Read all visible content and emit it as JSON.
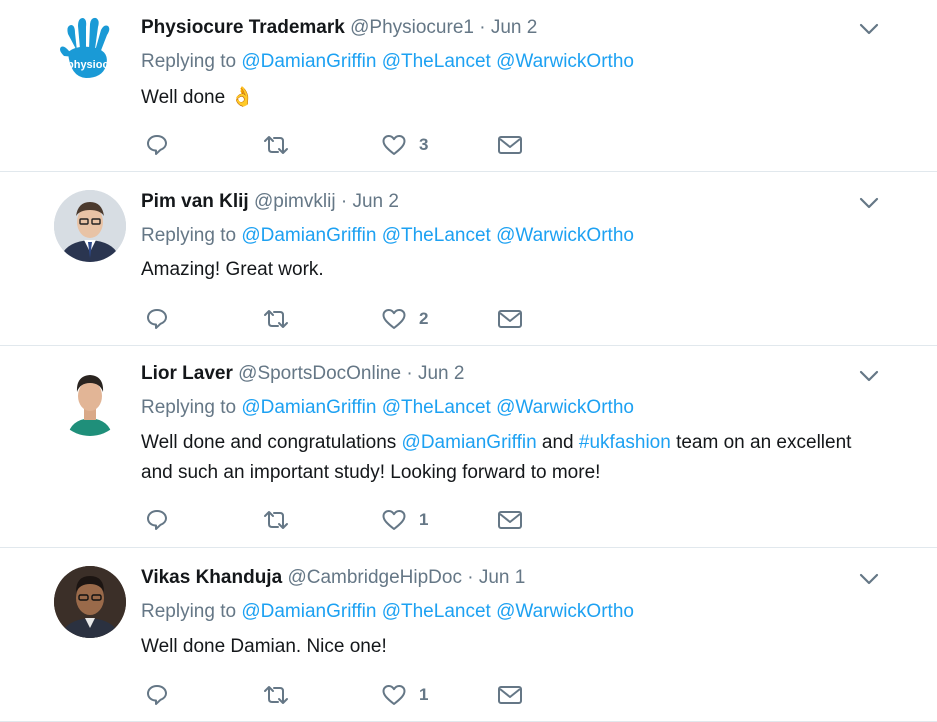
{
  "tweets": [
    {
      "name": "Physiocure Trademark",
      "handle": "@Physiocure1",
      "dot": "·",
      "date": "Jun 2",
      "replying_prefix": "Replying to",
      "mentions": [
        "@DamianGriffin",
        "@TheLancet",
        "@WarwickOrtho"
      ],
      "text": "Well done",
      "emoji": "👌",
      "likes": "3",
      "avatar_text": "physiocure"
    },
    {
      "name": "Pim van Klij",
      "handle": "@pimvklij",
      "dot": "·",
      "date": "Jun 2",
      "replying_prefix": "Replying to",
      "mentions": [
        "@DamianGriffin",
        "@TheLancet",
        "@WarwickOrtho"
      ],
      "text": "Amazing! Great work.",
      "likes": "2"
    },
    {
      "name": "Lior Laver",
      "handle": "@SportsDocOnline",
      "dot": "·",
      "date": "Jun 2",
      "replying_prefix": "Replying to",
      "mentions": [
        "@DamianGriffin",
        "@TheLancet",
        "@WarwickOrtho"
      ],
      "text_parts": [
        "Well done and congratulations ",
        "@DamianGriffin",
        " and ",
        "#ukfashion",
        " team on an excellent and such an important study! Looking forward to more!"
      ],
      "likes": "1"
    },
    {
      "name": "Vikas Khanduja",
      "handle": "@CambridgeHipDoc",
      "dot": "·",
      "date": "Jun 1",
      "replying_prefix": "Replying to",
      "mentions": [
        "@DamianGriffin",
        "@TheLancet",
        "@WarwickOrtho"
      ],
      "text": "Well done Damian. Nice one!",
      "likes": "1"
    }
  ],
  "icons": {
    "reply": "reply-icon",
    "retweet": "retweet-icon",
    "like": "heart-icon",
    "dm": "envelope-icon",
    "caret": "chevron-down-icon"
  },
  "colors": {
    "link": "#1da1f2",
    "muted": "#657786",
    "text": "#14171a",
    "divider": "#e1e8ed"
  }
}
